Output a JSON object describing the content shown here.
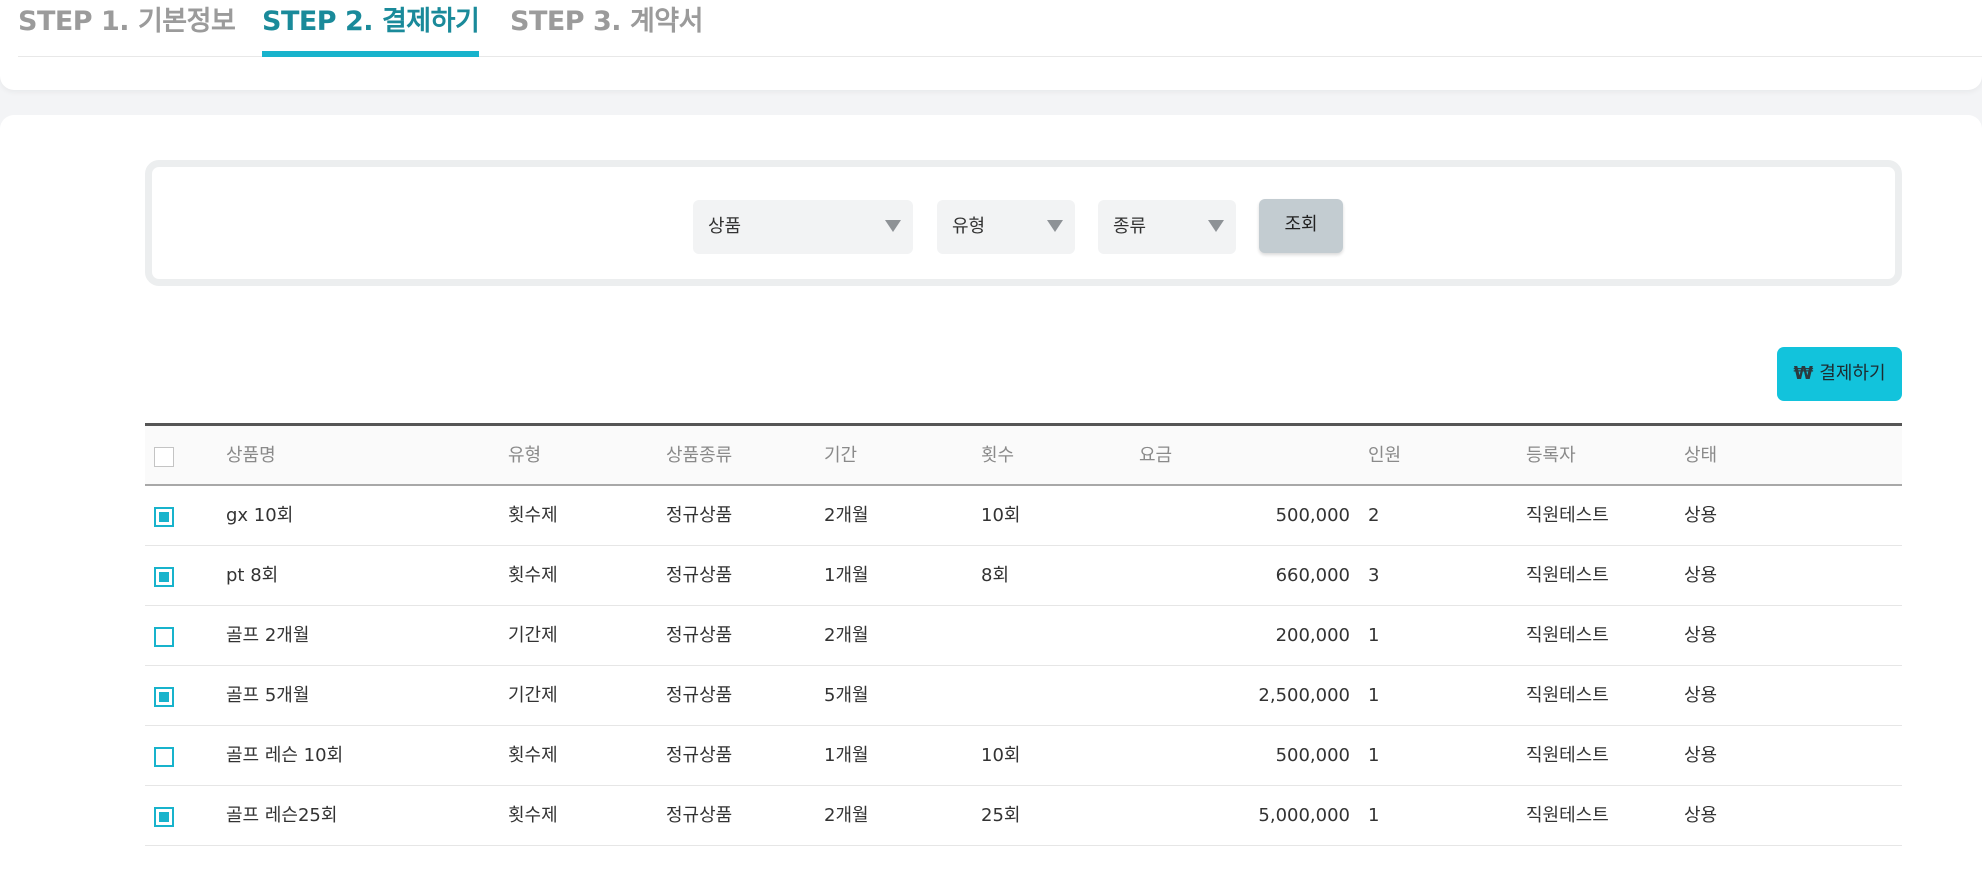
{
  "steps": [
    {
      "label": "STEP 1. 기본정보",
      "active": false
    },
    {
      "label": "STEP 2. 결제하기",
      "active": true
    },
    {
      "label": "STEP 3. 계약서",
      "active": false
    }
  ],
  "filters": {
    "product_select": "상품",
    "type_select": "유형",
    "kind_select": "종류",
    "search_label": "조회"
  },
  "actions": {
    "pay_icon": "₩",
    "pay_label": "결제하기"
  },
  "table": {
    "headers": {
      "name": "상품명",
      "type": "유형",
      "kind": "상품종류",
      "period": "기간",
      "count": "횟수",
      "fee": "요금",
      "people": "인원",
      "registrant": "등록자",
      "status": "상태"
    },
    "rows": [
      {
        "checked": true,
        "name": "gx 10회",
        "type": "횟수제",
        "kind": "정규상품",
        "period": "2개월",
        "count": "10회",
        "fee": "500,000",
        "people": "2",
        "registrant": "직원테스트",
        "status": "상용"
      },
      {
        "checked": true,
        "name": "pt 8회",
        "type": "횟수제",
        "kind": "정규상품",
        "period": "1개월",
        "count": "8회",
        "fee": "660,000",
        "people": "3",
        "registrant": "직원테스트",
        "status": "상용"
      },
      {
        "checked": false,
        "name": "골프 2개월",
        "type": "기간제",
        "kind": "정규상품",
        "period": "2개월",
        "count": "",
        "fee": "200,000",
        "people": "1",
        "registrant": "직원테스트",
        "status": "상용"
      },
      {
        "checked": true,
        "name": "골프 5개월",
        "type": "기간제",
        "kind": "정규상품",
        "period": "5개월",
        "count": "",
        "fee": "2,500,000",
        "people": "1",
        "registrant": "직원테스트",
        "status": "상용"
      },
      {
        "checked": false,
        "name": "골프 레슨 10회",
        "type": "횟수제",
        "kind": "정규상품",
        "period": "1개월",
        "count": "10회",
        "fee": "500,000",
        "people": "1",
        "registrant": "직원테스트",
        "status": "상용"
      },
      {
        "checked": true,
        "name": "골프 레슨25회",
        "type": "횟수제",
        "kind": "정규상품",
        "period": "2개월",
        "count": "25회",
        "fee": "5,000,000",
        "people": "1",
        "registrant": "직원테스트",
        "status": "상용"
      }
    ]
  },
  "colors": {
    "accent": "#18b3cc",
    "active_step": "#1a8a9a",
    "pay_button": "#12c3dc",
    "search_button": "#c3ccd1"
  }
}
